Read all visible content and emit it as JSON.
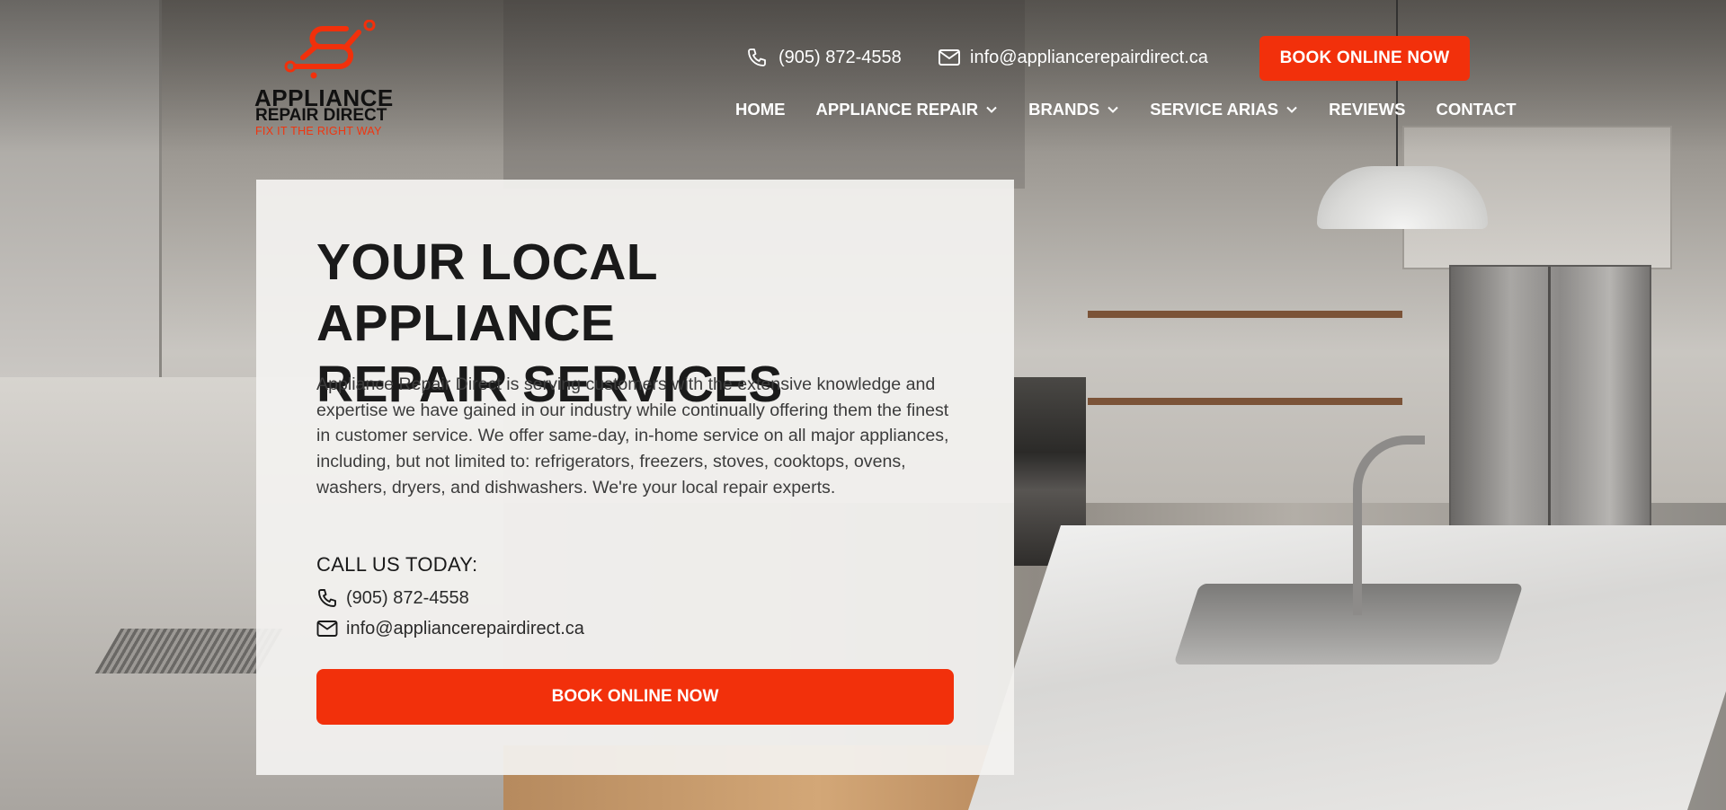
{
  "brand": {
    "name_line1": "APPLIANCE",
    "name_line2": "REPAIR DIRECT",
    "tagline": "FIX IT THE RIGHT WAY",
    "accent_color": "#f2300b"
  },
  "header": {
    "phone": "(905) 872-4558",
    "email": "info@appliancerepairdirect.ca",
    "cta_label": "BOOK ONLINE NOW",
    "phone_icon": "phone-icon",
    "email_icon": "mail-icon"
  },
  "nav": {
    "items": [
      {
        "label": "HOME",
        "has_dropdown": false
      },
      {
        "label": "APPLIANCE REPAIR",
        "has_dropdown": true
      },
      {
        "label": "BRANDS",
        "has_dropdown": true
      },
      {
        "label": "SERVICE ARIAS",
        "has_dropdown": true
      },
      {
        "label": "REVIEWS",
        "has_dropdown": false
      },
      {
        "label": "CONTACT",
        "has_dropdown": false
      }
    ]
  },
  "hero": {
    "title_line1": "YOUR LOCAL APPLIANCE",
    "title_line2": "REPAIR SERVICES",
    "description": "Appliance Repair Direct is serving customers with the extensive knowledge and expertise we have gained in our industry while continually offering them the finest in customer service. We offer same-day, in-home service on all major appliances, including, but not limited to: refrigerators, freezers, stoves, cooktops, ovens, washers, dryers, and dishwashers. We're your local repair experts.",
    "call_heading": "CALL US TODAY:",
    "phone": "(905) 872-4558",
    "email": "info@appliancerepairdirect.ca",
    "cta_label": "BOOK ONLINE NOW"
  }
}
